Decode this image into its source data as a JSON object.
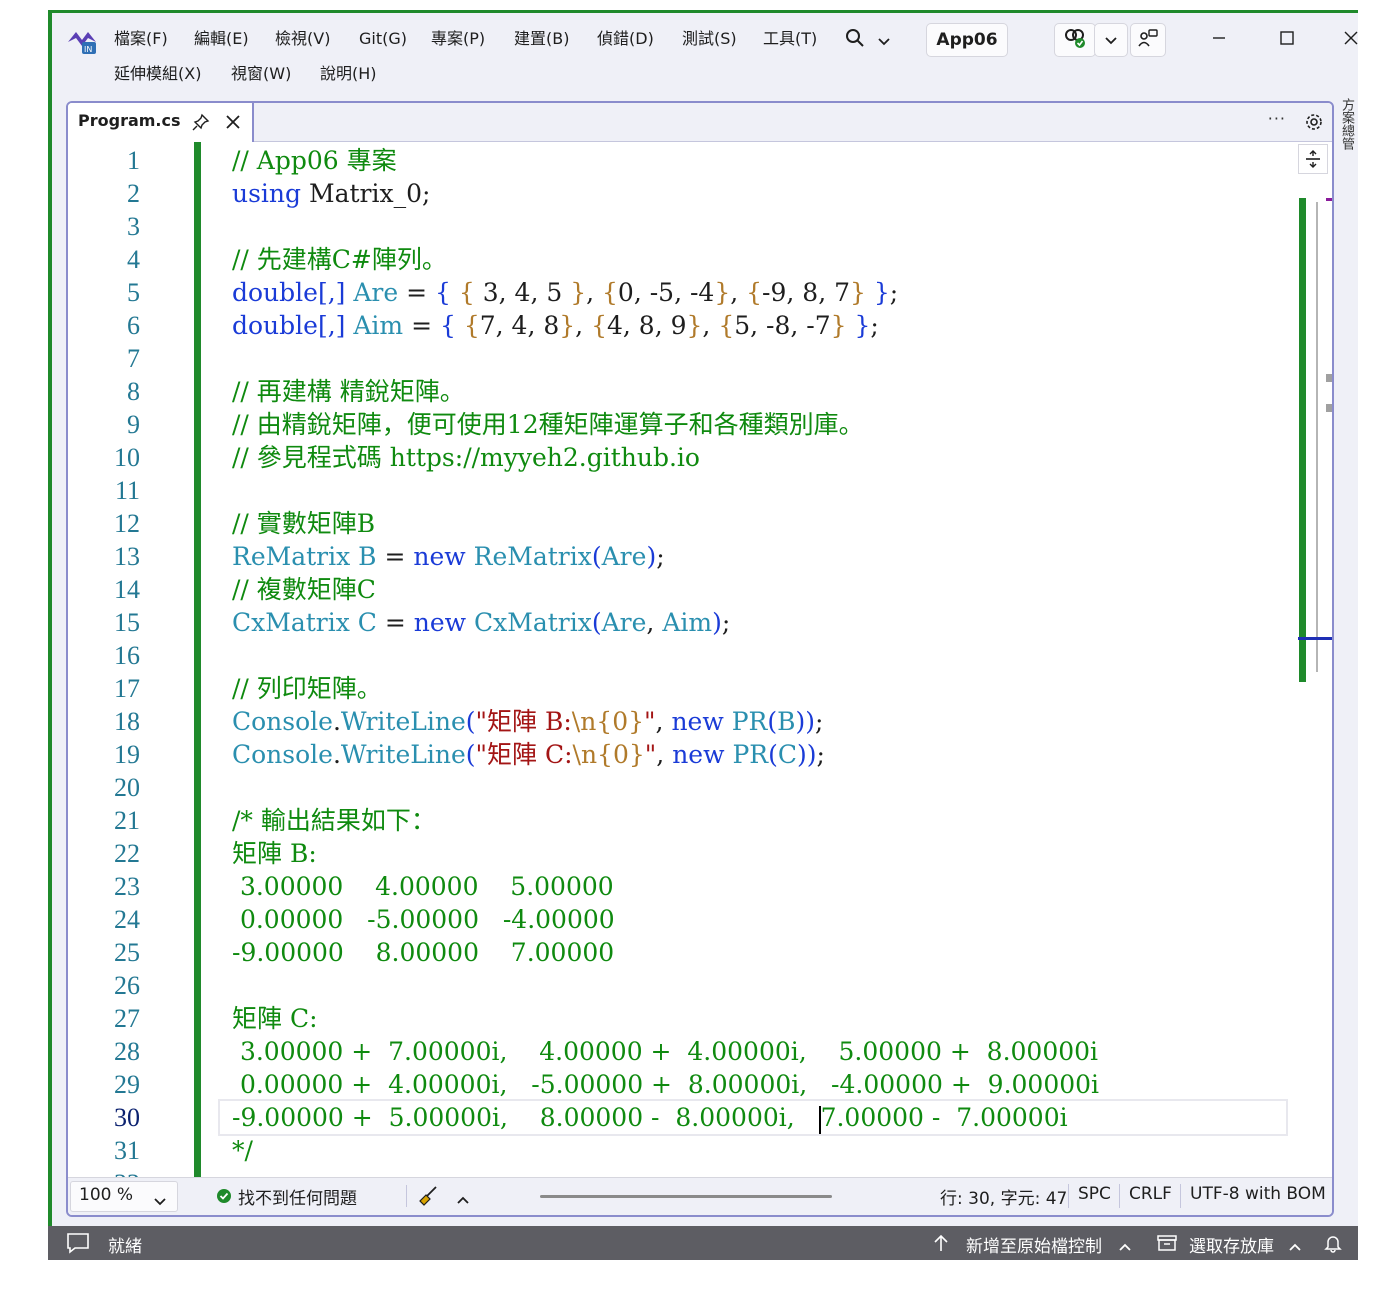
{
  "menu": {
    "file": "檔案(F)",
    "edit": "編輯(E)",
    "view": "檢視(V)",
    "git": "Git(G)",
    "project": "專案(P)",
    "build": "建置(B)",
    "debug": "偵錯(D)",
    "test": "測試(S)",
    "tools": "工具(T)",
    "extensions": "延伸模組(X)",
    "window": "視窗(W)",
    "help": "說明(H)"
  },
  "solution_name": "App06",
  "tab": {
    "title": "Program.cs",
    "more": "···"
  },
  "side_rail": "方案總管",
  "editor": {
    "current_line": 30,
    "lines": [
      {
        "n": "1",
        "segs": [
          [
            "comment",
            "// App06 專案"
          ]
        ]
      },
      {
        "n": "2",
        "segs": [
          [
            "kw",
            "using"
          ],
          [
            "tx",
            " Matrix_0;"
          ]
        ]
      },
      {
        "n": "3",
        "segs": []
      },
      {
        "n": "4",
        "segs": [
          [
            "comment",
            "// 先建構C#陣列。"
          ]
        ]
      },
      {
        "n": "5",
        "segs": [
          [
            "kw",
            "double"
          ],
          [
            "br",
            "[,]"
          ],
          [
            "tx",
            " "
          ],
          [
            "tp",
            "Are"
          ],
          [
            "tx",
            " = "
          ],
          [
            "br",
            "{"
          ],
          [
            "tx",
            " "
          ],
          [
            "brg",
            "{"
          ],
          [
            "tx",
            " 3, 4, 5 "
          ],
          [
            "brg",
            "}"
          ],
          [
            "tx",
            ", "
          ],
          [
            "brg",
            "{"
          ],
          [
            "tx",
            "0, -5, -4"
          ],
          [
            "brg",
            "}"
          ],
          [
            "tx",
            ", "
          ],
          [
            "brg",
            "{"
          ],
          [
            "tx",
            "-9, 8, 7"
          ],
          [
            "brg",
            "}"
          ],
          [
            "tx",
            " "
          ],
          [
            "br",
            "}"
          ],
          [
            "tx",
            ";"
          ]
        ]
      },
      {
        "n": "6",
        "segs": [
          [
            "kw",
            "double"
          ],
          [
            "br",
            "[,]"
          ],
          [
            "tx",
            " "
          ],
          [
            "tp",
            "Aim"
          ],
          [
            "tx",
            " = "
          ],
          [
            "br",
            "{"
          ],
          [
            "tx",
            " "
          ],
          [
            "brg",
            "{"
          ],
          [
            "tx",
            "7, 4, 8"
          ],
          [
            "brg",
            "}"
          ],
          [
            "tx",
            ", "
          ],
          [
            "brg",
            "{"
          ],
          [
            "tx",
            "4, 8, 9"
          ],
          [
            "brg",
            "}"
          ],
          [
            "tx",
            ", "
          ],
          [
            "brg",
            "{"
          ],
          [
            "tx",
            "5, -8, -7"
          ],
          [
            "brg",
            "}"
          ],
          [
            "tx",
            " "
          ],
          [
            "br",
            "}"
          ],
          [
            "tx",
            ";"
          ]
        ]
      },
      {
        "n": "7",
        "segs": []
      },
      {
        "n": "8",
        "segs": [
          [
            "comment",
            "// 再建構 精銳矩陣。"
          ]
        ]
      },
      {
        "n": "9",
        "segs": [
          [
            "comment",
            "// 由精銳矩陣，便可使用12種矩陣運算子和各種類別庫。"
          ]
        ]
      },
      {
        "n": "10",
        "segs": [
          [
            "comment",
            "// 參見程式碼 https://myyeh2.github.io"
          ]
        ]
      },
      {
        "n": "11",
        "segs": []
      },
      {
        "n": "12",
        "segs": [
          [
            "comment",
            "// 實數矩陣B"
          ]
        ]
      },
      {
        "n": "13",
        "segs": [
          [
            "tp",
            "ReMatrix"
          ],
          [
            "tx",
            " "
          ],
          [
            "tp",
            "B"
          ],
          [
            "tx",
            " = "
          ],
          [
            "kw",
            "new"
          ],
          [
            "tx",
            " "
          ],
          [
            "tp",
            "ReMatrix"
          ],
          [
            "br",
            "("
          ],
          [
            "tp",
            "Are"
          ],
          [
            "br",
            ")"
          ],
          [
            "tx",
            ";"
          ]
        ]
      },
      {
        "n": "14",
        "segs": [
          [
            "comment",
            "// 複數矩陣C"
          ]
        ]
      },
      {
        "n": "15",
        "segs": [
          [
            "tp",
            "CxMatrix"
          ],
          [
            "tx",
            " "
          ],
          [
            "tp",
            "C"
          ],
          [
            "tx",
            " = "
          ],
          [
            "kw",
            "new"
          ],
          [
            "tx",
            " "
          ],
          [
            "tp",
            "CxMatrix"
          ],
          [
            "br",
            "("
          ],
          [
            "tp",
            "Are"
          ],
          [
            "tx",
            ", "
          ],
          [
            "tp",
            "Aim"
          ],
          [
            "br",
            ")"
          ],
          [
            "tx",
            ";"
          ]
        ]
      },
      {
        "n": "16",
        "segs": []
      },
      {
        "n": "17",
        "segs": [
          [
            "comment",
            "// 列印矩陣。"
          ]
        ]
      },
      {
        "n": "18",
        "segs": [
          [
            "tp",
            "Console"
          ],
          [
            "tx",
            "."
          ],
          [
            "tp",
            "WriteLine"
          ],
          [
            "br",
            "("
          ],
          [
            "str",
            "\"矩陣 B:"
          ],
          [
            "esc",
            "\\n{0}"
          ],
          [
            "str",
            "\""
          ],
          [
            "tx",
            ", "
          ],
          [
            "kw",
            "new"
          ],
          [
            "tx",
            " "
          ],
          [
            "tp",
            "PR"
          ],
          [
            "br",
            "("
          ],
          [
            "tp",
            "B"
          ],
          [
            "br",
            "))"
          ],
          [
            "tx",
            ";"
          ]
        ]
      },
      {
        "n": "19",
        "segs": [
          [
            "tp",
            "Console"
          ],
          [
            "tx",
            "."
          ],
          [
            "tp",
            "WriteLine"
          ],
          [
            "br",
            "("
          ],
          [
            "str",
            "\"矩陣 C:"
          ],
          [
            "esc",
            "\\n{0}"
          ],
          [
            "str",
            "\""
          ],
          [
            "tx",
            ", "
          ],
          [
            "kw",
            "new"
          ],
          [
            "tx",
            " "
          ],
          [
            "tp",
            "PR"
          ],
          [
            "br",
            "("
          ],
          [
            "tp",
            "C"
          ],
          [
            "br",
            "))"
          ],
          [
            "tx",
            ";"
          ]
        ]
      },
      {
        "n": "20",
        "segs": []
      },
      {
        "n": "21",
        "segs": [
          [
            "comment",
            "/* 輸出結果如下："
          ]
        ]
      },
      {
        "n": "22",
        "segs": [
          [
            "comment",
            "矩陣 B:"
          ]
        ]
      },
      {
        "n": "23",
        "segs": [
          [
            "comment",
            " 3.00000    4.00000    5.00000"
          ]
        ]
      },
      {
        "n": "24",
        "segs": [
          [
            "comment",
            " 0.00000   -5.00000   -4.00000"
          ]
        ]
      },
      {
        "n": "25",
        "segs": [
          [
            "comment",
            "-9.00000    8.00000    7.00000"
          ]
        ]
      },
      {
        "n": "26",
        "segs": []
      },
      {
        "n": "27",
        "segs": [
          [
            "comment",
            "矩陣 C:"
          ]
        ]
      },
      {
        "n": "28",
        "segs": [
          [
            "comment",
            " 3.00000 +  7.00000i,    4.00000 +  4.00000i,    5.00000 +  8.00000i"
          ]
        ]
      },
      {
        "n": "29",
        "segs": [
          [
            "comment",
            " 0.00000 +  4.00000i,   -5.00000 +  8.00000i,   -4.00000 +  9.00000i"
          ]
        ]
      },
      {
        "n": "30",
        "segs": [
          [
            "comment",
            "-9.00000 +  5.00000i,    8.00000 -  8.00000i,   "
          ],
          [
            "caret",
            ""
          ],
          [
            "comment",
            "7.00000 -  7.00000i"
          ]
        ]
      },
      {
        "n": "31",
        "segs": [
          [
            "comment",
            "*/"
          ]
        ]
      },
      {
        "n": "32",
        "segs": []
      }
    ]
  },
  "status": {
    "zoom": "100 %",
    "issues": "找不到任何問題",
    "position": "行: 30, 字元: 47",
    "spacing": "SPC",
    "line_ending": "CRLF",
    "encoding": "UTF-8 with BOM"
  },
  "app_status": {
    "ready": "就緒",
    "source_control": "新增至原始檔控制",
    "repository": "選取存放庫"
  },
  "colors": {
    "comment": "#0f8a0f",
    "keyword": "#1a3bd7",
    "type": "#2a8faf",
    "string": "#a31515",
    "accent_green": "#1f8a2b",
    "status_bar": "#5d5d63"
  },
  "icons": [
    "vs-logo-icon",
    "search-icon",
    "chevron-down-icon",
    "copilot-icon",
    "live-share-icon",
    "minimize-icon",
    "maximize-icon",
    "close-icon",
    "pin-icon",
    "gear-icon",
    "split-icon",
    "check-circle-icon",
    "broom-icon",
    "arrow-up-icon",
    "comment-icon",
    "repository-icon",
    "bell-icon"
  ]
}
